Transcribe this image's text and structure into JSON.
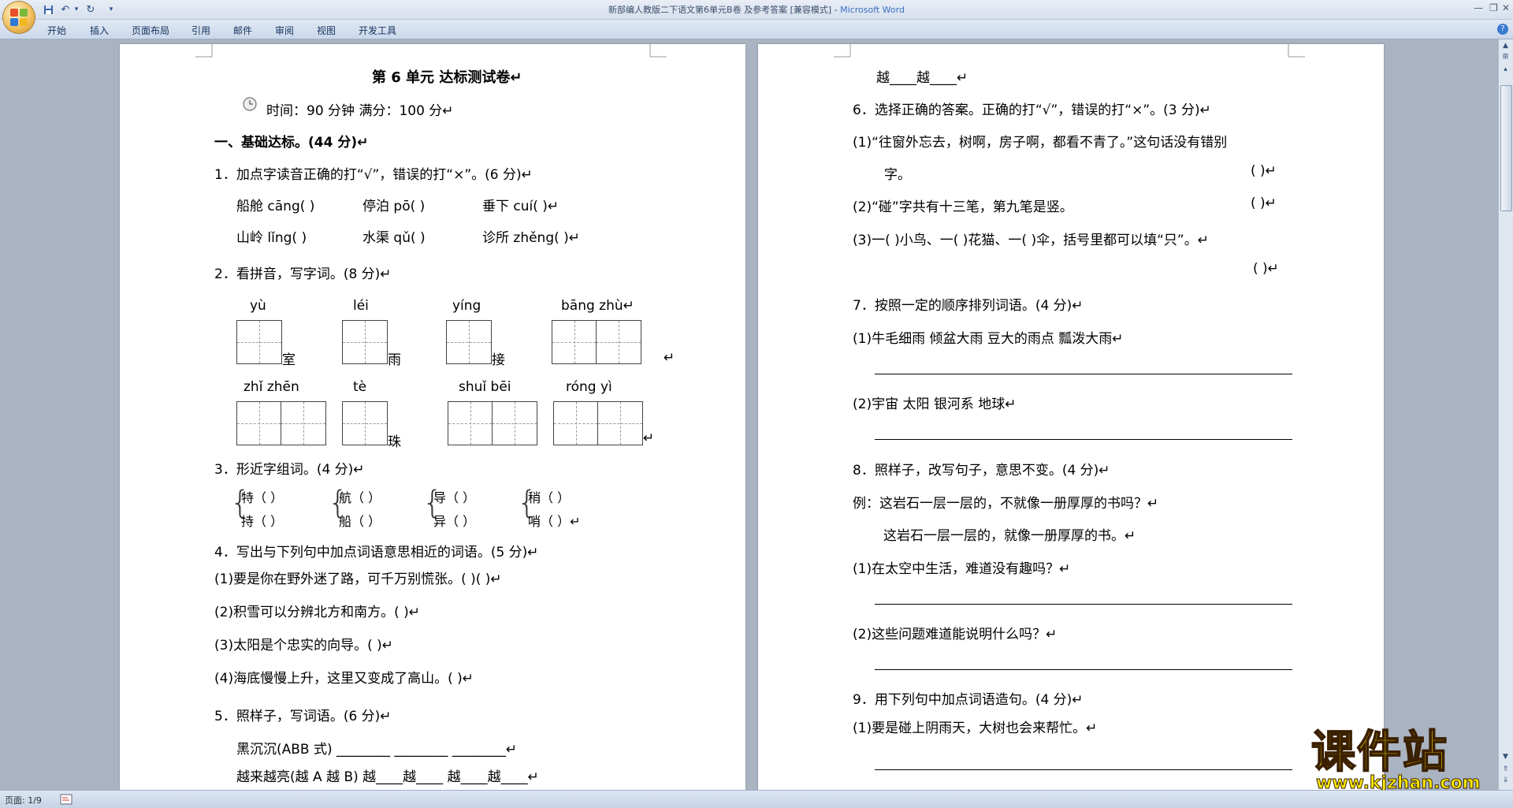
{
  "window": {
    "title": "新部编人教版二下语文第6单元B卷 及参考答案 [兼容模式] - ",
    "app_name": "Microsoft Word"
  },
  "ribbon_tabs": [
    "开始",
    "插入",
    "页面布局",
    "引用",
    "邮件",
    "审阅",
    "视图",
    "开发工具"
  ],
  "status": {
    "page": "页面: 1/9"
  },
  "watermark": {
    "title": "课件站",
    "url": "www.kjzhan.com"
  },
  "left_page": {
    "title": "第 6 单元  达标测试卷↵",
    "time_line": "时间：90 分钟  满分：100 分↵",
    "section1": "一、基础达标。(44 分)↵",
    "q1": "1．加点字读音正确的打“√”，错误的打“×”。(6 分)↵",
    "q1_row1": [
      "船舱 cāng(    )",
      "停泊 pō(    )",
      "垂下 cuí(    )↵"
    ],
    "q1_row2": [
      "山岭 lǐng(    )",
      "水渠 qǔ(    )",
      "诊所 zhěng(    )↵"
    ],
    "q2": "2．看拼音，写字词。(8 分)↵",
    "q2_row1_pinyin": [
      "yù",
      "léi",
      "yíng",
      "bāng  zhù↵"
    ],
    "q2_row1_suffix": [
      "室",
      "雨",
      "接"
    ],
    "q2_row2_pinyin": [
      "zhǐ   zhēn",
      "tè",
      "shuǐ   bēi",
      "róng   yì"
    ],
    "q2_row2_suffix": [
      "珠"
    ],
    "q3": "3．形近字组词。(4 分)↵",
    "q3_pairs": [
      [
        "特（      ）",
        "持（      ）"
      ],
      [
        "航（      ）",
        "船（      ）"
      ],
      [
        "导（      ）",
        "异（      ）"
      ],
      [
        "稍（      ）",
        "哨（      ）↵"
      ]
    ],
    "q4": "4．写出与下列句中加点词语意思相近的词语。(5 分)↵",
    "q4_items": [
      "(1)要是你在野外迷了路，可千万别慌张。(     )(     )↵",
      "(2)积雪可以分辨北方和南方。(     )↵",
      "(3)太阳是个忠实的向导。(     )↵",
      "(4)海底慢慢上升，这里又变成了高山。(     )↵"
    ],
    "q5": "5．照样子，写词语。(6 分)↵",
    "q5_row1": "黑沉沉(ABB 式)   ________  ________  ________↵",
    "q5_row2": "越来越亮(越 A 越 B)      越____越____       越____越____↵"
  },
  "right_page": {
    "top_line": "越____越____↵",
    "q6": "6．选择正确的答案。正确的打“√”，错误的打“×”。(3 分)↵",
    "q6_1a": "(1)“往窗外忘去，树啊，房子啊，都看不青了。”这句话没有错别",
    "q6_1b": "字。",
    "q6_1_ans": "(     )↵",
    "q6_2": "(2)“碰”字共有十三笔，第九笔是竖。",
    "q6_2_ans": "(     )↵",
    "q6_3": "(3)一(  )小鸟、一(  )花猫、一(  )伞，括号里都可以填“只”。↵",
    "q6_3_ans": "(     )↵",
    "q7": "7．按照一定的顺序排列词语。(4 分)↵",
    "q7_1": "(1)牛毛细雨  倾盆大雨  豆大的雨点  瓢泼大雨↵",
    "q7_2": "(2)宇宙  太阳  银河系  地球↵",
    "q8": "8．照样子，改写句子，意思不变。(4 分)↵",
    "q8_ex1": "例：这岩石一层一层的，不就像一册厚厚的书吗？↵",
    "q8_ex2": "这岩石一层一层的，就像一册厚厚的书。↵",
    "q8_1": "(1)在太空中生活，难道没有趣吗？↵",
    "q8_2": "(2)这些问题难道能说明什么吗？↵",
    "q9": "9．用下列句中加点词语造句。(4 分)↵",
    "q9_1": "(1)要是碰上阴雨天，大树也会来帮忙。↵",
    "line_mark": "↵"
  }
}
